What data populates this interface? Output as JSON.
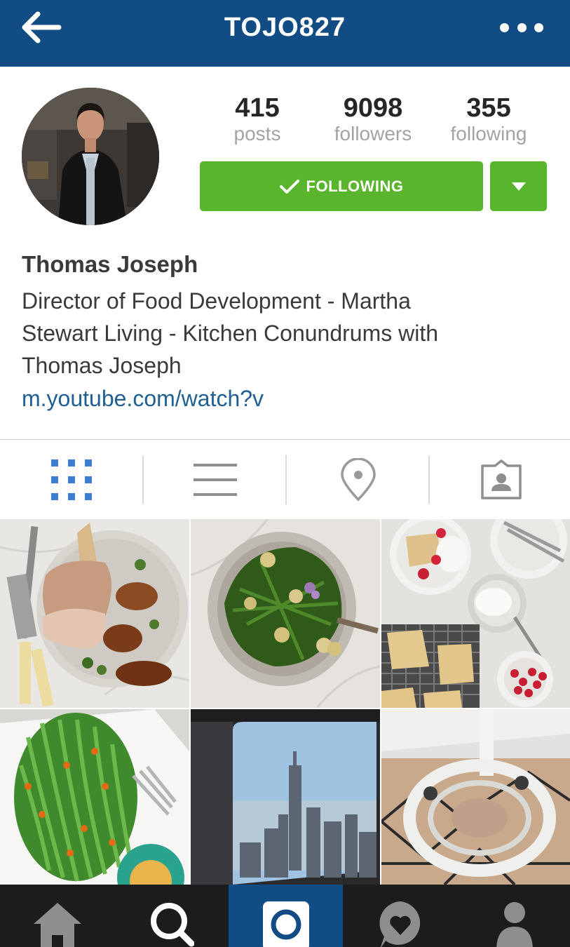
{
  "header": {
    "title": "TOJO827",
    "back_icon": "arrow-left-icon",
    "more_icon": "more-dots-icon",
    "background_color": "#124c84"
  },
  "profile": {
    "avatar_icon": "avatar",
    "stats": [
      {
        "value": "415",
        "label": "posts"
      },
      {
        "value": "9098",
        "label": "followers"
      },
      {
        "value": "355",
        "label": "following"
      }
    ],
    "follow_button_label": "FOLLOWING",
    "follow_button_color": "#58b52c",
    "name": "Thomas Joseph",
    "bio_lines": [
      "Director of Food Development - Martha",
      "Stewart Living - Kitchen Conundrums with",
      "Thomas Joseph"
    ],
    "link": "m.youtube.com/watch?v"
  },
  "view_tabs": [
    {
      "icon": "grid-icon",
      "active": true
    },
    {
      "icon": "list-icon",
      "active": false
    },
    {
      "icon": "location-pin-icon",
      "active": false
    },
    {
      "icon": "tagged-photos-icon",
      "active": false
    }
  ],
  "photos": [
    {
      "subject": "roast pork with shallots"
    },
    {
      "subject": "green bean and potato salad"
    },
    {
      "subject": "scones with cream and raspberries"
    },
    {
      "subject": "asparagus platter"
    },
    {
      "subject": "city skyline from airplane window"
    },
    {
      "subject": "spiral staircase from above"
    }
  ],
  "bottom_nav": [
    {
      "icon": "home-icon",
      "active": false
    },
    {
      "icon": "search-icon",
      "active": false
    },
    {
      "icon": "camera-icon",
      "active": true
    },
    {
      "icon": "activity-heart-icon",
      "active": false
    },
    {
      "icon": "profile-icon",
      "active": false
    }
  ]
}
